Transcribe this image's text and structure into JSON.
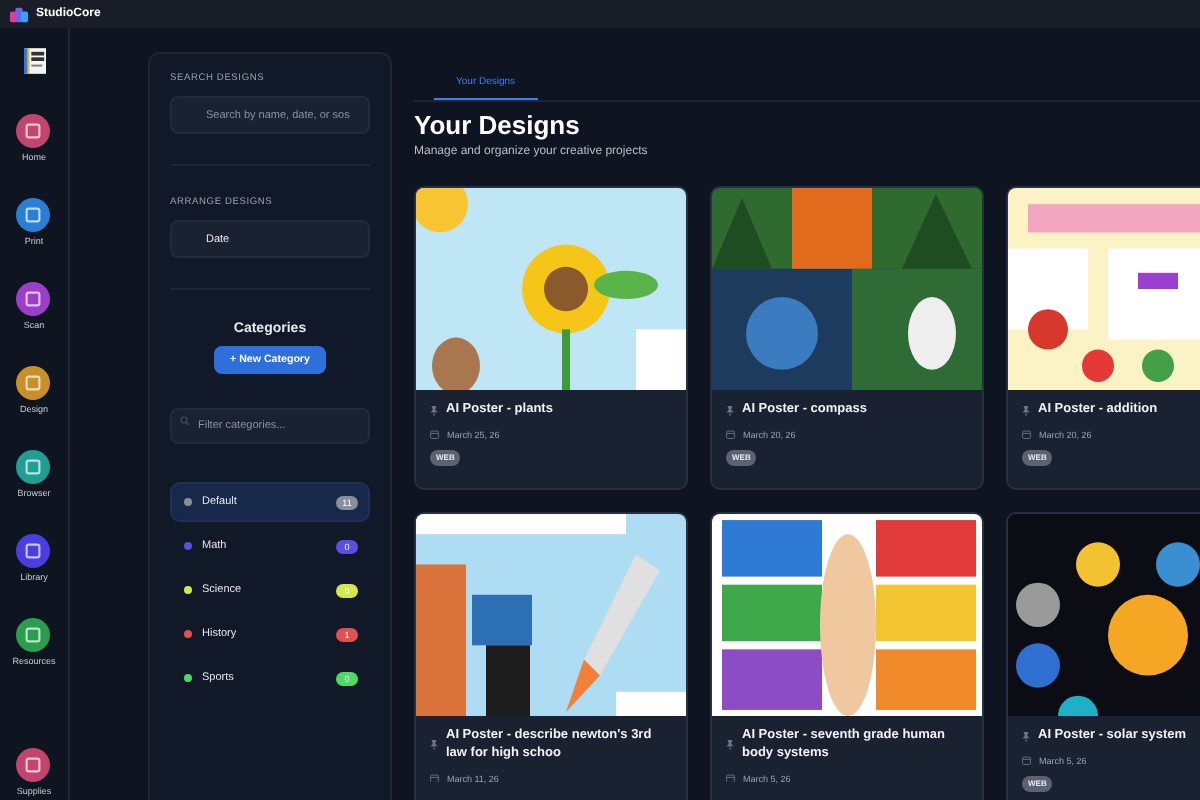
{
  "window": {
    "title": "StudioCore"
  },
  "nav": [
    {
      "label": "Home",
      "color": "#c2456e"
    },
    {
      "label": "Print",
      "color": "#2a7fd4"
    },
    {
      "label": "Scan",
      "color": "#9b3fc9"
    },
    {
      "label": "Design",
      "color": "#c98f2a"
    },
    {
      "label": "Browser",
      "color": "#1f9e94"
    },
    {
      "label": "Library",
      "color": "#4a3ee0"
    },
    {
      "label": "Resources",
      "color": "#2a9d4f"
    },
    {
      "label": "Supplies",
      "color": "#c2456e"
    }
  ],
  "sidebar": {
    "search_label": "SEARCH DESIGNS",
    "search": {
      "placeholder": "Search by name, date, or sos"
    },
    "arrange_label": "ARRANGE DESIGNS",
    "arrange": {
      "value": "Date"
    },
    "categories_title": "Categories",
    "new_button": "+ New Category",
    "filter": {
      "placeholder": "Filter categories..."
    },
    "categories": [
      {
        "name": "Default",
        "count": "11",
        "color": "#8a8f9c",
        "selected": true
      },
      {
        "name": "Math",
        "count": "0",
        "color": "#5b4fe0",
        "selected": false
      },
      {
        "name": "Science",
        "count": "0",
        "color": "#d4e84a",
        "selected": false
      },
      {
        "name": "History",
        "count": "1",
        "color": "#e05050",
        "selected": false
      },
      {
        "name": "Sports",
        "count": "0",
        "color": "#4cd964",
        "selected": false
      }
    ]
  },
  "tabs": [
    {
      "label": "Your Designs",
      "selected": true
    }
  ],
  "heading": "Your Designs",
  "subtitle": "Manage and organize your creative projects",
  "cards": [
    {
      "title": "AI Poster - plants",
      "date": "March 25, 26",
      "badge": "WEB"
    },
    {
      "title": "AI Poster - compass",
      "date": "March 20, 26",
      "badge": "WEB"
    },
    {
      "title": "AI Poster - addition",
      "date": "March 20, 26",
      "badge": "WEB"
    },
    {
      "title": "AI Poster - describe newton's 3rd law for high schoo",
      "date": "March 11, 26"
    },
    {
      "title": "AI Poster - seventh grade human body systems",
      "date": "March 5, 26"
    },
    {
      "title": "AI Poster - solar system",
      "date": "March 5, 26",
      "badge": "WEB"
    }
  ]
}
